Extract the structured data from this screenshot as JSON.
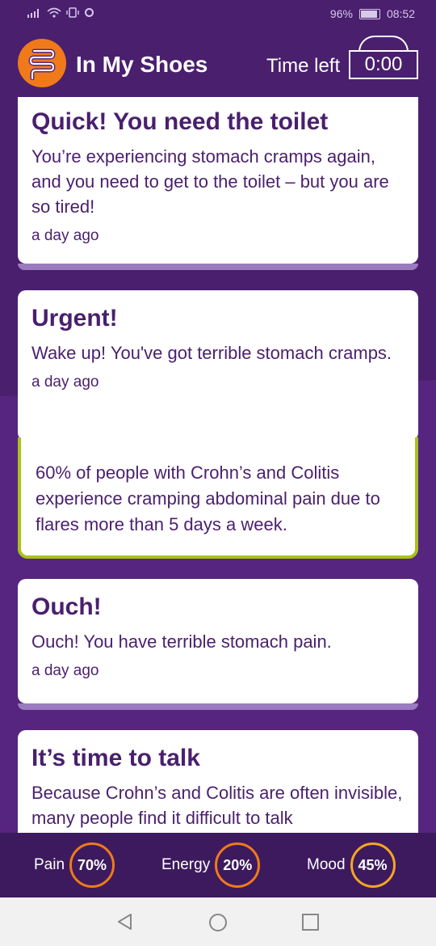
{
  "status": {
    "battery": "96%",
    "time": "08:52"
  },
  "header": {
    "app_title": "In My Shoes",
    "time_left_label": "Time left",
    "timer_value": "0:00"
  },
  "cards": [
    {
      "title": "Quick! You need the toilet",
      "body": "You’re experiencing stomach cramps again, and you need to get to the toilet – but you are so tired!",
      "time": "a day ago"
    },
    {
      "title": "Urgent!",
      "body": " Wake up! You've got terrible stomach cramps.",
      "time": "a day ago"
    },
    {
      "title": "Ouch!",
      "body": "Ouch! You have terrible stomach pain.",
      "time": "a day ago"
    },
    {
      "title": "It’s time to talk",
      "body": "Because Crohn’s and Colitis are often invisible, many people find it difficult to talk"
    }
  ],
  "fact": {
    "text": "60% of people with Crohn’s and Colitis experience cramping abdominal pain due to flares more than 5 days a week."
  },
  "stats": [
    {
      "label": "Pain",
      "value": "70%",
      "color": "#f07a1a"
    },
    {
      "label": "Energy",
      "value": "20%",
      "color": "#f07a1a"
    },
    {
      "label": "Mood",
      "value": "45%",
      "color": "#f5a623"
    }
  ],
  "colors": {
    "primary": "#4a1f6e",
    "accent_orange": "#f07a1a",
    "fact_border": "#a8c21a"
  },
  "icons": {
    "logo": "intestine-icon",
    "nav_back": "back-triangle-icon",
    "nav_home": "home-circle-icon",
    "nav_recent": "recent-square-icon"
  }
}
